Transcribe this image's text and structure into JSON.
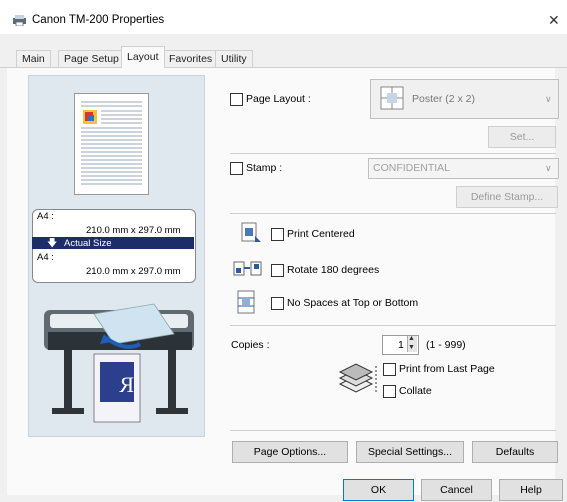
{
  "window": {
    "title": "Canon TM-200 Properties",
    "close_glyph": "✕"
  },
  "tabs": [
    {
      "label": "Main"
    },
    {
      "label": "Page Setup"
    },
    {
      "label": "Layout",
      "active": true
    },
    {
      "label": "Favorites"
    },
    {
      "label": "Utility"
    }
  ],
  "preview": {
    "from_size": "A4 :",
    "from_dims": "210.0 mm x 297.0 mm",
    "mode": "Actual Size",
    "to_size": "A4 :",
    "to_dims": "210.0 mm x 297.0 mm"
  },
  "layout": {
    "page_layout_label": "Page Layout :",
    "page_layout_checked": false,
    "page_layout_value": "Poster (2 x 2)",
    "set_button": "Set...",
    "stamp_label": "Stamp :",
    "stamp_checked": false,
    "stamp_value": "CONFIDENTIAL",
    "define_stamp_button": "Define Stamp...",
    "print_centered": "Print Centered",
    "rotate_180": "Rotate 180 degrees",
    "no_spaces": "No Spaces at Top or Bottom",
    "copies_label": "Copies :",
    "copies_value": "1",
    "copies_range": "(1 - 999)",
    "print_from_last": "Print from Last Page",
    "collate": "Collate"
  },
  "buttons": {
    "page_options": "Page Options...",
    "special_settings": "Special Settings...",
    "defaults": "Defaults",
    "ok": "OK",
    "cancel": "Cancel",
    "help": "Help"
  },
  "colors": {
    "accent": "#0078d7",
    "selection": "#1c2d6a"
  }
}
